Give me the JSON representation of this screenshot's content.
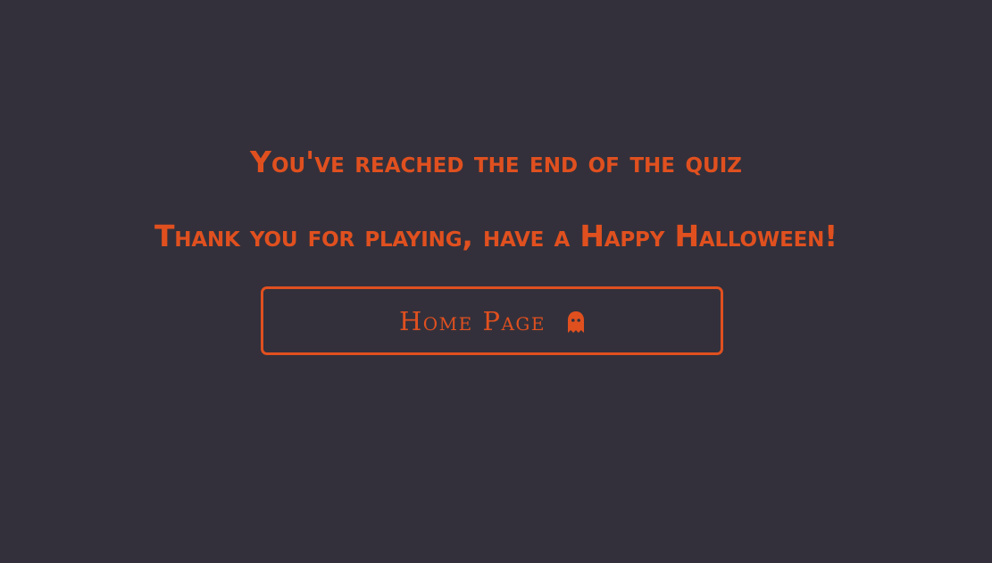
{
  "end_screen": {
    "heading": "You've reached the end of the quiz",
    "subheading": "Thank you for playing, have a Happy Halloween!",
    "home_button": {
      "label": "Home Page",
      "icon": "ghost-icon"
    }
  },
  "colors": {
    "background": "#33303b",
    "accent": "#e0501f"
  }
}
